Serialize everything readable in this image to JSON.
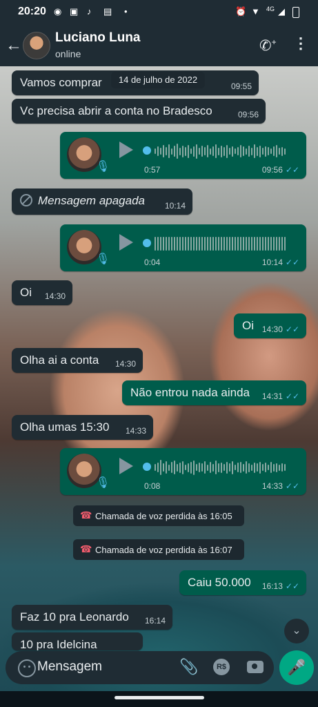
{
  "status_bar": {
    "time": "20:20",
    "network": "4G"
  },
  "header": {
    "contact_name": "Luciano Luna",
    "presence": "online"
  },
  "date_chip": "14 de julho de 2022",
  "messages": {
    "m1": {
      "text": "Vamos  comprar",
      "time": "09:55"
    },
    "m2": {
      "text": "Vc precisa abrir a conta  no Bradesco",
      "time": "09:56"
    },
    "v1": {
      "duration": "0:57",
      "time": "09:56"
    },
    "m3": {
      "text": "Mensagem apagada",
      "time": "10:14"
    },
    "v2": {
      "duration": "0:04",
      "time": "10:14"
    },
    "m4": {
      "text": "Oi",
      "time": "14:30"
    },
    "m5": {
      "text": "Oi",
      "time": "14:30"
    },
    "m6": {
      "text": "Olha ai a conta",
      "time": "14:30"
    },
    "m7": {
      "text": "Não entrou nada ainda",
      "time": "14:31"
    },
    "m8": {
      "text": "Olha umas 15:30",
      "time": "14:33"
    },
    "v3": {
      "duration": "0:08",
      "time": "14:33"
    },
    "c1": {
      "text": "Chamada de voz perdida às 16:05"
    },
    "c2": {
      "text": "Chamada de voz perdida às 16:07"
    },
    "m9": {
      "text": "Caiu 50.000",
      "time": "16:13"
    },
    "m10": {
      "text": "Faz 10 pra Leonardo",
      "time": "16:14"
    },
    "m11": {
      "text": "10 pra Idelcina"
    }
  },
  "composer": {
    "placeholder": "Mensagem",
    "pix_label": "R$"
  },
  "colors": {
    "incoming": "#202c33",
    "outgoing": "#005c4b",
    "accent": "#00a884",
    "read_ticks": "#53bdeb"
  },
  "icons": [
    "back-arrow-icon",
    "add-call-icon",
    "more-menu-icon",
    "play-icon",
    "mic-icon",
    "deleted-icon",
    "missed-call-icon",
    "chevron-down-icon",
    "emoji-icon",
    "attach-icon",
    "pix-icon",
    "camera-icon"
  ]
}
